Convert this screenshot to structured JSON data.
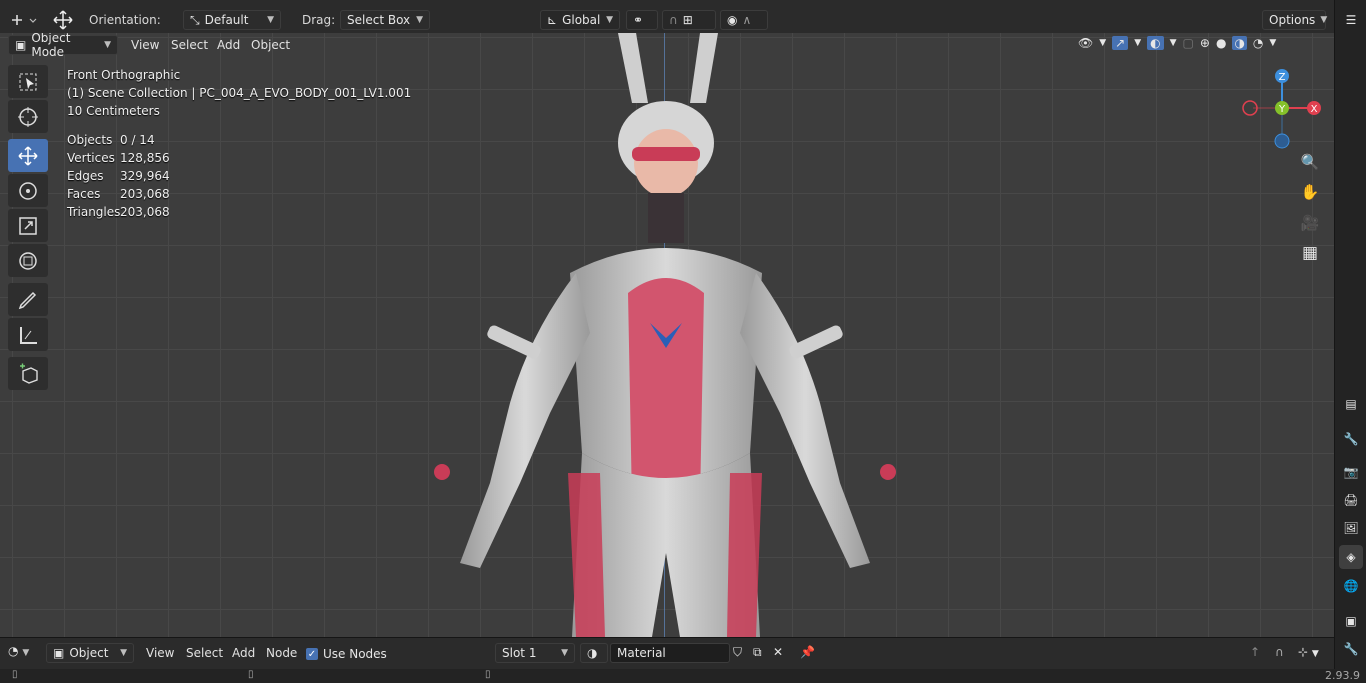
{
  "tool_settings": {
    "orientation_label": "Orientation:",
    "orientation_value": "Default",
    "drag_label": "Drag:",
    "drag_value": "Select Box",
    "transform_orientation": "Global",
    "options_label": "Options"
  },
  "viewport_header": {
    "mode": "Object Mode",
    "menus": [
      "View",
      "Select",
      "Add",
      "Object"
    ]
  },
  "overlay": {
    "view_name": "Front Orthographic",
    "collection": "(1) Scene Collection | PC_004_A_EVO_BODY_001_LV1.001",
    "scale": "10 Centimeters",
    "stats": [
      {
        "label": "Objects",
        "value": "0 / 14"
      },
      {
        "label": "Vertices",
        "value": "128,856"
      },
      {
        "label": "Edges",
        "value": "329,964"
      },
      {
        "label": "Faces",
        "value": "203,068"
      },
      {
        "label": "Triangles",
        "value": "203,068"
      }
    ]
  },
  "gizmo": {
    "z": "Z",
    "y": "Y",
    "x": "X"
  },
  "node_header": {
    "editor": "Object",
    "menus": [
      "View",
      "Select",
      "Add",
      "Node"
    ],
    "use_nodes_label": "Use Nodes",
    "slot": "Slot 1",
    "material": "Material"
  },
  "status": {
    "version": "2.93.9"
  },
  "colors": {
    "accent": "#4772b3",
    "x_axis": "#e0404f",
    "y_axis": "#85c12a",
    "z_axis": "#3d8fdd"
  }
}
